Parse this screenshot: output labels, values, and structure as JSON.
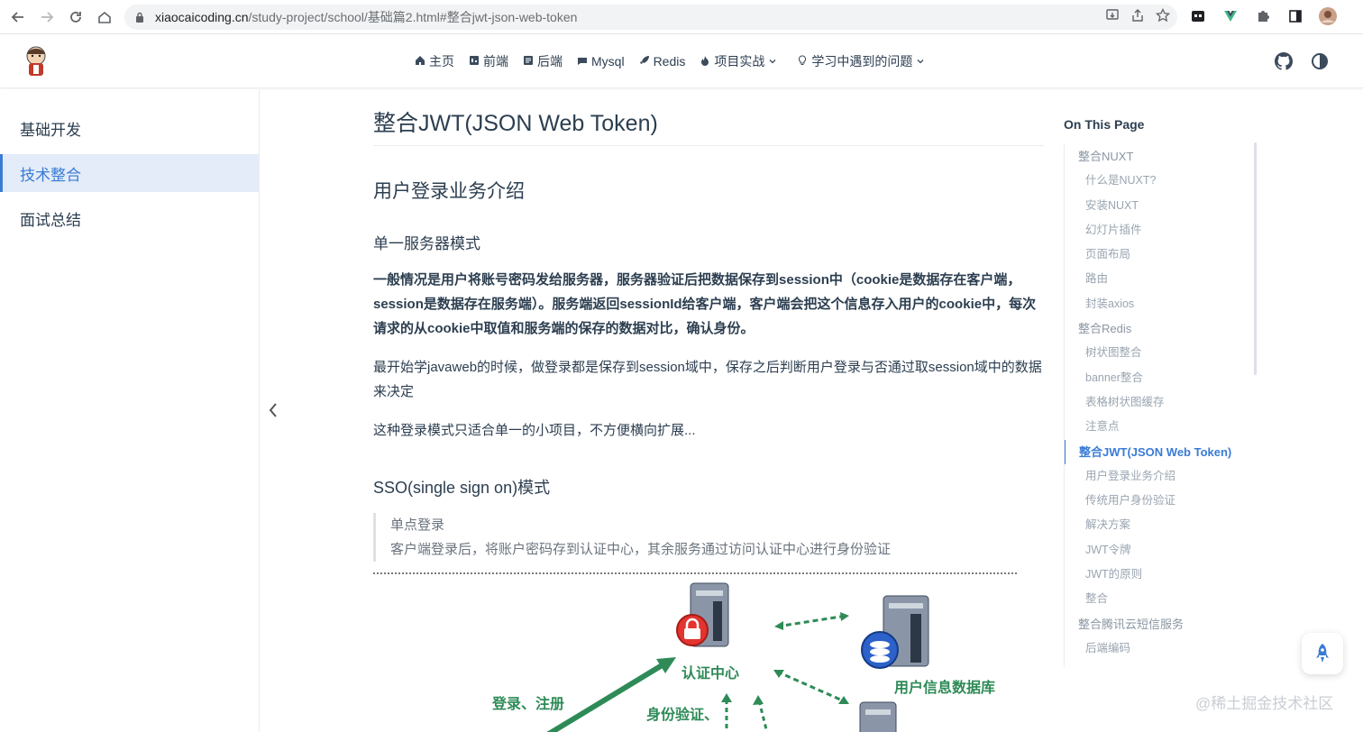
{
  "browser": {
    "url_host": "xiaocaicoding.cn",
    "url_path": "/study-project/school/基础篇2.html#整合jwt-json-web-token"
  },
  "header": {
    "nav": [
      {
        "icon": "home-icon",
        "label": "主页"
      },
      {
        "icon": "frontend-icon",
        "label": "前端"
      },
      {
        "icon": "backend-icon",
        "label": "后端"
      },
      {
        "icon": "mysql-icon",
        "label": "Mysql"
      },
      {
        "icon": "rocket-icon",
        "label": "Redis"
      },
      {
        "icon": "fire-icon",
        "label": "项目实战",
        "dropdown": true
      },
      {
        "icon": "bulb-icon",
        "label": "学习中遇到的问题",
        "dropdown": true
      }
    ]
  },
  "sidebar": {
    "items": [
      {
        "label": "基础开发",
        "active": false
      },
      {
        "label": "技术整合",
        "active": true
      },
      {
        "label": "面试总结",
        "active": false
      }
    ]
  },
  "content": {
    "h1": "整合JWT(JSON Web Token)",
    "h2": "用户登录业务介绍",
    "h3_single": "单一服务器模式",
    "p1": "一般情况是用户将账号密码发给服务器，服务器验证后把数据保存到session中（cookie是数据存在客户端，session是数据存在服务端）。服务端返回sessionId给客户端，客户端会把这个信息存入用户的cookie中，每次请求的从cookie中取值和服务端的保存的数据对比，确认身份。",
    "p2": "最开始学javaweb的时候，做登录都是保存到session域中，保存之后判断用户登录与否通过取session域中的数据来决定",
    "p3": "这种登录模式只适合单一的小项目，不方便横向扩展...",
    "h3_sso": "SSO(single sign on)模式",
    "quote_line1": "单点登录",
    "quote_line2": "客户端登录后，将账户密码存到认证中心，其余服务通过访问认证中心进行身份验证",
    "diagram": {
      "auth_center": "认证中心",
      "user_db": "用户信息数据库",
      "login_register": "登录、注册",
      "identity_verify": "身份验证、"
    }
  },
  "toc": {
    "title": "On This Page",
    "items": [
      {
        "label": "整合NUXT",
        "level": 1
      },
      {
        "label": "什么是NUXT?",
        "level": 2
      },
      {
        "label": "安装NUXT",
        "level": 2
      },
      {
        "label": "幻灯片插件",
        "level": 2
      },
      {
        "label": "页面布局",
        "level": 2
      },
      {
        "label": "路由",
        "level": 2
      },
      {
        "label": "封装axios",
        "level": 2
      },
      {
        "label": "整合Redis",
        "level": 1
      },
      {
        "label": "树状图整合",
        "level": 2
      },
      {
        "label": "banner整合",
        "level": 2
      },
      {
        "label": "表格树状图缓存",
        "level": 2
      },
      {
        "label": "注意点",
        "level": 2
      },
      {
        "label": "整合JWT(JSON Web Token)",
        "level": 1,
        "active": true
      },
      {
        "label": "用户登录业务介绍",
        "level": 2
      },
      {
        "label": "传统用户身份验证",
        "level": 2
      },
      {
        "label": "解决方案",
        "level": 2
      },
      {
        "label": "JWT令牌",
        "level": 2
      },
      {
        "label": "JWT的原则",
        "level": 2
      },
      {
        "label": "整合",
        "level": 2
      },
      {
        "label": "整合腾讯云短信服务",
        "level": 1
      },
      {
        "label": "后端编码",
        "level": 2
      }
    ]
  },
  "watermark": "@稀土掘金技术社区",
  "colors": {
    "accent": "#3a7bd5",
    "active_bg": "#e3ecf8",
    "text": "#2c3e50"
  }
}
